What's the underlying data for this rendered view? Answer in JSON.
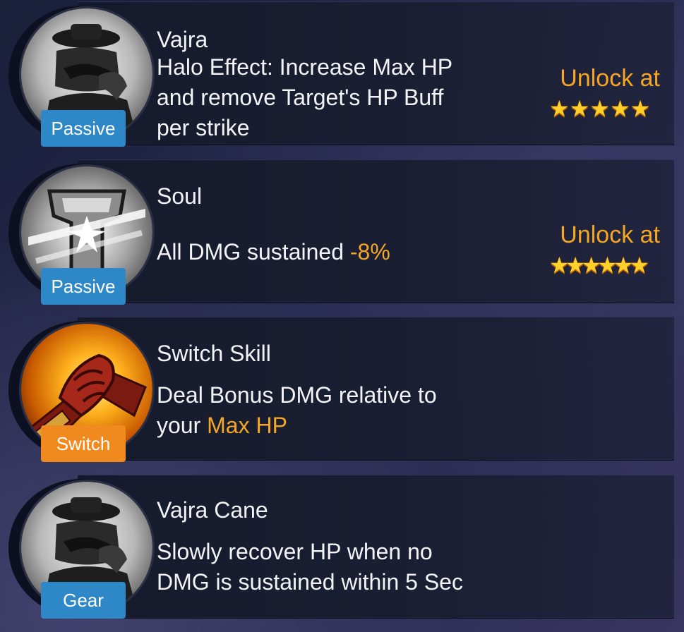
{
  "skills": [
    {
      "name": "Vajra",
      "desc_lines": [
        "Halo Effect: Increase Max HP",
        "and remove Target's HP Buff",
        "per strike"
      ],
      "badge": "Passive",
      "badge_color": "#2e88c8",
      "icon": "masked-warrior-icon",
      "unlock_label": "Unlock at",
      "unlock_stars": 5
    },
    {
      "name": "Soul",
      "desc_prefix": "All DMG sustained ",
      "desc_highlight": "-8%",
      "badge": "Passive",
      "badge_color": "#2e88c8",
      "icon": "shield-burst-icon",
      "unlock_label": "Unlock at",
      "unlock_stars": 6
    },
    {
      "name": "Switch Skill",
      "desc_line1": "Deal Bonus DMG relative to",
      "desc_line2_prefix": "your ",
      "desc_line2_highlight": "Max HP",
      "badge": "Switch",
      "badge_color": "#f08a1e",
      "icon": "handshake-icon"
    },
    {
      "name": "Vajra Cane",
      "desc_lines": [
        "Slowly recover HP when no",
        "DMG is sustained within 5 Sec"
      ],
      "badge": "Gear",
      "badge_color": "#2e88c8",
      "icon": "masked-warrior-icon"
    }
  ],
  "colors": {
    "highlight": "#f5a623",
    "star": "#ffcf2a"
  }
}
